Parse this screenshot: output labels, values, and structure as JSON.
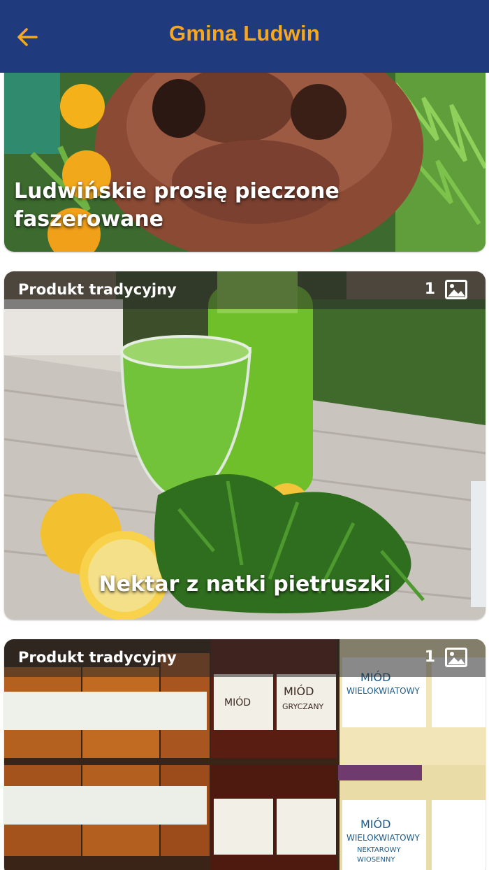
{
  "header": {
    "title": "Gmina Ludwin"
  },
  "cards": [
    {
      "title": "Ludwińskie prosię pieczone faszerowane",
      "image": "roast-piglet-photo"
    },
    {
      "tag": "Produkt tradycyjny",
      "photo_count": "1",
      "title": "Nektar z natki pietruszki",
      "image": "parsley-nectar-photo"
    },
    {
      "tag": "Produkt tradycyjny",
      "photo_count": "1",
      "image": "honey-jars-photo",
      "jar_labels": [
        "MIÓD",
        "GRYCZANY",
        "MIÓD",
        "WIELOKWIATOWY",
        "NEKTAROWY",
        "WIOSENNY",
        "MIÓD",
        "WIELOKWIATOWY",
        "NEKTAROWY",
        "WIOSENNY"
      ]
    }
  ],
  "colors": {
    "header_bg": "#1f3a7d",
    "header_accent": "#f5a623"
  },
  "icons": {
    "back": "arrow-left-icon",
    "photos": "image-icon"
  }
}
